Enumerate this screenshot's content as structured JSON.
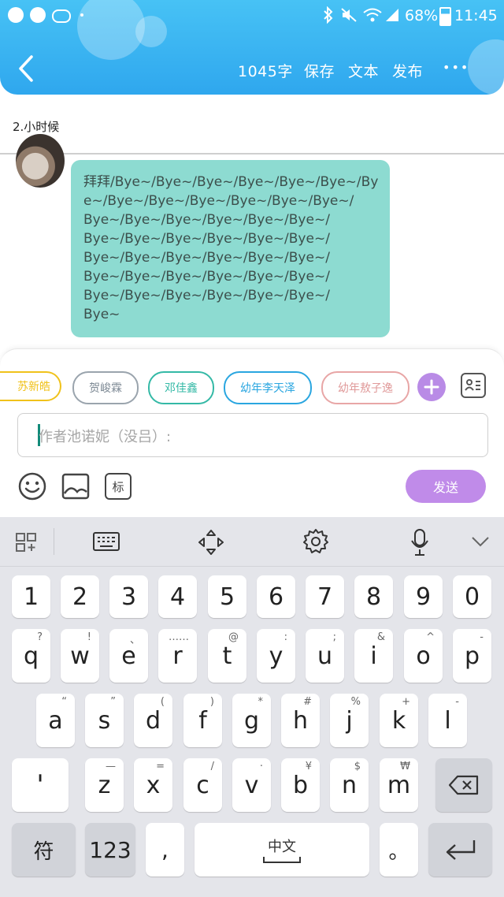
{
  "status_bar": {
    "battery": "68%",
    "time": "11:45"
  },
  "header": {
    "word_count": "1045字",
    "save": "保存",
    "text": "文本",
    "publish": "发布",
    "more": "•••"
  },
  "chapter": {
    "title": "2.小时候"
  },
  "message": {
    "text": "拜拜/Bye~/Bye~/Bye~/Bye~/Bye~/Bye~/Bye~/Bye~/Bye~/Bye~/Bye~/Bye~/Bye~/\nBye~/Bye~/Bye~/Bye~/Bye~/Bye~/\nBye~/Bye~/Bye~/Bye~/Bye~/Bye~/\nBye~/Bye~/Bye~/Bye~/Bye~/Bye~/\nBye~/Bye~/Bye~/Bye~/Bye~/Bye~/\nBye~/Bye~/Bye~/Bye~/Bye~/Bye~/\nBye~"
  },
  "characters": [
    {
      "name": "苏新皓",
      "color": "#f0c21b"
    },
    {
      "name": "贺峻霖",
      "color": "#9aa4ad"
    },
    {
      "name": "邓佳鑫",
      "color": "#34b9a6"
    },
    {
      "name": "幼年李天泽",
      "color": "#2aa6e0"
    },
    {
      "name": "幼年敖子逸",
      "color": "#e8a6a6"
    }
  ],
  "input": {
    "placeholder": "作者池诺妮（没吕）:"
  },
  "toolbar": {
    "sticker_label": "标",
    "send_label": "发送"
  },
  "keyboard": {
    "numbers": [
      "1",
      "2",
      "3",
      "4",
      "5",
      "6",
      "7",
      "8",
      "9",
      "0"
    ],
    "row1": [
      {
        "k": "q",
        "h": "?"
      },
      {
        "k": "w",
        "h": "!"
      },
      {
        "k": "e",
        "h": "、"
      },
      {
        "k": "r",
        "h": "……"
      },
      {
        "k": "t",
        "h": "@"
      },
      {
        "k": "y",
        "h": ":"
      },
      {
        "k": "u",
        "h": ";"
      },
      {
        "k": "i",
        "h": "&"
      },
      {
        "k": "o",
        "h": "^"
      },
      {
        "k": "p",
        "h": "-"
      }
    ],
    "row2": [
      {
        "k": "a",
        "h": "“"
      },
      {
        "k": "s",
        "h": "”"
      },
      {
        "k": "d",
        "h": "("
      },
      {
        "k": "f",
        "h": ")"
      },
      {
        "k": "g",
        "h": "*"
      },
      {
        "k": "h",
        "h": "#"
      },
      {
        "k": "j",
        "h": "%"
      },
      {
        "k": "k",
        "h": "+"
      },
      {
        "k": "l",
        "h": "-"
      }
    ],
    "row3": [
      {
        "k": "z",
        "h": "—"
      },
      {
        "k": "x",
        "h": "="
      },
      {
        "k": "c",
        "h": "/"
      },
      {
        "k": "v",
        "h": "·"
      },
      {
        "k": "b",
        "h": "¥"
      },
      {
        "k": "n",
        "h": "$"
      },
      {
        "k": "m",
        "h": "₩"
      }
    ],
    "apostrophe": "'",
    "fu": "符",
    "num_switch": "123",
    "comma": ",",
    "space": "中文",
    "period": "。"
  }
}
